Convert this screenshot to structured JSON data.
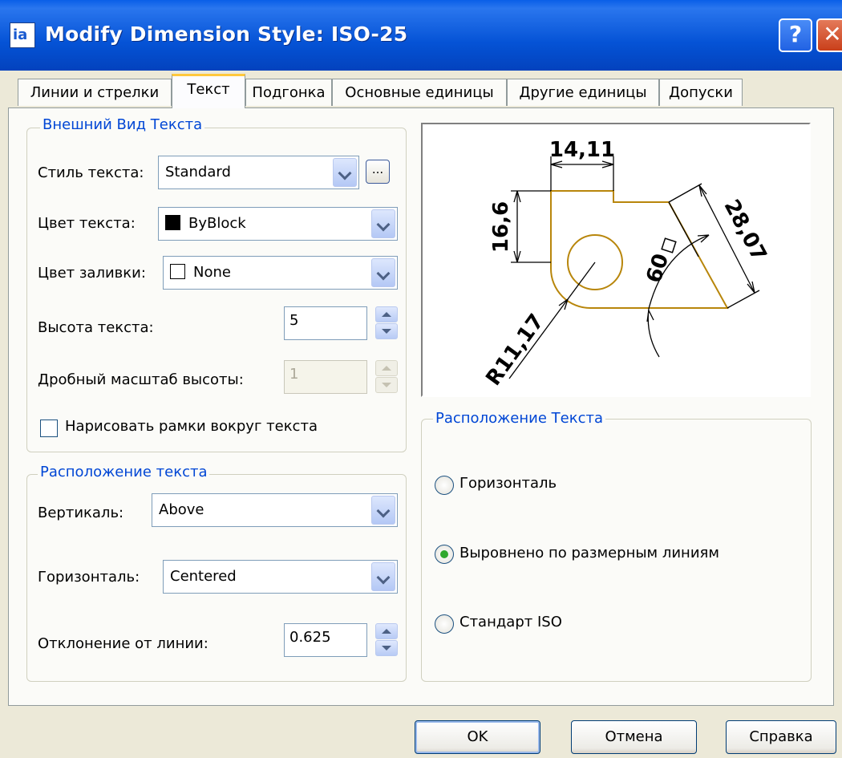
{
  "window": {
    "title": "Modify Dimension Style: ISO-25",
    "help_glyph": "?",
    "close_glyph": "✕",
    "app_icon_glyph": "ia"
  },
  "tabs": [
    {
      "label": "Линии и стрелки",
      "active": false
    },
    {
      "label": "Текст",
      "active": true
    },
    {
      "label": "Подгонка",
      "active": false
    },
    {
      "label": "Основные единицы",
      "active": false
    },
    {
      "label": "Другие единицы",
      "active": false
    },
    {
      "label": "Допуски",
      "active": false
    }
  ],
  "appearance": {
    "legend": "Внешний Вид Текста",
    "text_style_label": "Стиль текста:",
    "text_style_value": "Standard",
    "ellipsis_label": "...",
    "text_color_label": "Цвет текста:",
    "text_color_value": "ByBlock",
    "fill_color_label": "Цвет заливки:",
    "fill_color_value": "None",
    "text_height_label": "Высота текста:",
    "text_height_value": "5",
    "fraction_scale_label": "Дробный масштаб высоты:",
    "fraction_scale_value": "1",
    "frame_checkbox_label": "Нарисовать рамки вокруг текста",
    "frame_checked": false
  },
  "placement": {
    "legend": "Расположение текста",
    "vertical_label": "Вертикаль:",
    "vertical_value": "Above",
    "horizontal_label": "Горизонталь:",
    "horizontal_value": "Centered",
    "offset_label": "Отклонение от линии:",
    "offset_value": "0.625"
  },
  "alignment": {
    "legend": "Расположение Текста",
    "options": [
      {
        "label": "Горизонталь",
        "selected": false
      },
      {
        "label": "Выровнено по размерным линиям",
        "selected": true
      },
      {
        "label": "Стандарт ISO",
        "selected": false
      }
    ]
  },
  "preview": {
    "dim_top": "14,11",
    "dim_left": "16,6",
    "dim_right": "28,07",
    "dim_angle": "60",
    "dim_radius": "R11,17"
  },
  "buttons": {
    "ok": "OK",
    "cancel": "Отмена",
    "help": "Справка"
  },
  "colors": {
    "title_bar": "#0553d6",
    "group_legend": "#0046d5",
    "preview_shape": "#b8860b",
    "selected_radio": "#2fa82e"
  }
}
